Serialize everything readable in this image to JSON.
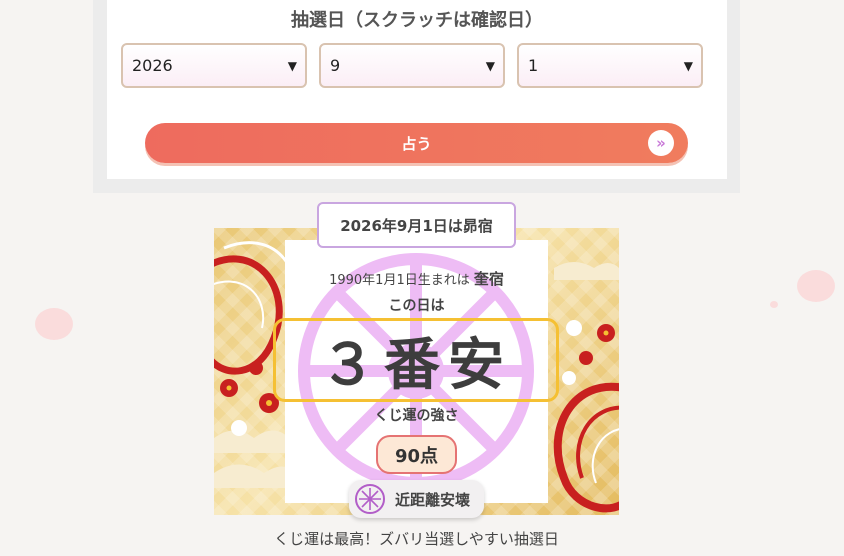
{
  "form": {
    "date_label": "抽選日（スクラッチは確認日）",
    "year": "2026",
    "month": "9",
    "day": "1",
    "submit_label": "占う",
    "submit_icon": "double-chevron-right"
  },
  "result": {
    "date_badge": "2026年9月1日は昴宿",
    "birth_prefix": "1990年1月1日生まれは",
    "birth_mansion": "奎宿",
    "day_label": "この日は",
    "rank": "３番安",
    "strength_label": "くじ運の強さ",
    "score": "90点",
    "relation": "近距離安壊",
    "relation_icon": "dharma-wheel",
    "summary": "くじ運は最高！ズバリ当選しやすい抽選日"
  },
  "colors": {
    "accent": "#ee6b5e",
    "badge_border": "#c9a6e0",
    "rank_border": "#f5c033",
    "wheel": "#e9b8f0"
  }
}
